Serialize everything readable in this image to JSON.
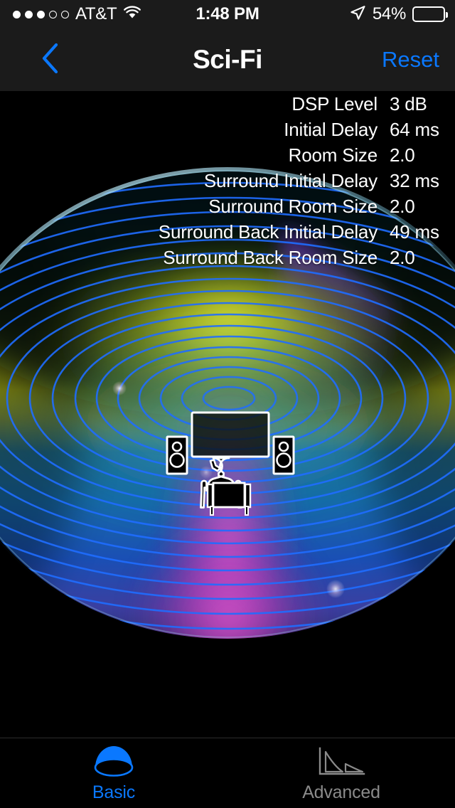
{
  "status_bar": {
    "signal_dots_filled": 3,
    "signal_dots_total": 5,
    "carrier": "AT&T",
    "wifi_icon": "wifi-icon",
    "time": "1:48 PM",
    "location_icon": "location-arrow-icon",
    "battery_percent": "54%",
    "battery_level": 54
  },
  "nav_bar": {
    "back_icon": "chevron-left-icon",
    "title": "Sci-Fi",
    "reset_label": "Reset",
    "accent_color": "#0a78ff"
  },
  "parameters": [
    {
      "label": "DSP Level",
      "value": "3 dB"
    },
    {
      "label": "Initial Delay",
      "value": "64 ms"
    },
    {
      "label": "Room Size",
      "value": "2.0"
    },
    {
      "label": "Surround Initial Delay",
      "value": "32 ms"
    },
    {
      "label": "Surround Room Size",
      "value": "2.0"
    },
    {
      "label": "Surround Back Initial Delay",
      "value": "49 ms"
    },
    {
      "label": "Surround Back Room Size",
      "value": "2.0"
    }
  ],
  "visualization": {
    "description": "Sound field dome with concentric wavefront rings, TV, two speakers and seated listener",
    "ring_color": "#1f6dff",
    "dome_rim_color": "#b9e4ef",
    "field_colors": {
      "top_dark": "#04060f",
      "olive": "#8f9a20",
      "yellow": "#cfd51f",
      "teal": "#12708f",
      "blue": "#1540b8",
      "magenta": "#c23ab0"
    },
    "elements": {
      "tv": "television-screen",
      "left_speaker": "left-speaker",
      "right_speaker": "right-speaker",
      "listener": "seated-listener"
    }
  },
  "tab_bar": {
    "tabs": [
      {
        "label": "Basic",
        "icon": "dome-icon",
        "active": true
      },
      {
        "label": "Advanced",
        "icon": "decay-curve-icon",
        "active": false
      }
    ]
  }
}
